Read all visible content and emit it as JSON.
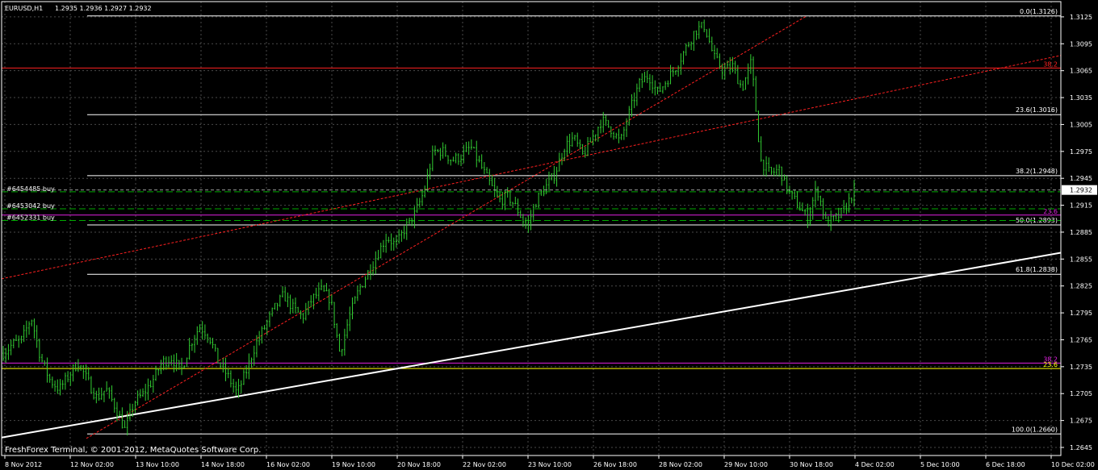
{
  "header": {
    "symbol_tf": "EURUSD,H1",
    "ohlc": "1.2935 1.2936 1.2927 1.2932"
  },
  "footer": {
    "copyright": "FreshForex Terminal, © 2001-2012, MetaQuotes Software Corp."
  },
  "colors": {
    "background": "#000000",
    "frame": "#ffffff",
    "grid": "#4a4a4a",
    "candle": "#32cd32",
    "fib_main": "#ffffff",
    "fib_red": "#ff2020",
    "fib_magenta": "#e020e0",
    "fib_yellow": "#ffff00",
    "order_line": "#00aa00",
    "trend_red": "#ff2020",
    "trend_white": "#ffffff"
  },
  "chart_data": {
    "type": "candlestick",
    "ylim": [
      1.2636,
      1.3142
    ],
    "y_ticks": [
      "1.3125",
      "1.3095",
      "1.3065",
      "1.3035",
      "1.3005",
      "1.2975",
      "1.2945",
      "1.2915",
      "1.2885",
      "1.2855",
      "1.2825",
      "1.2795",
      "1.2765",
      "1.2735",
      "1.2705",
      "1.2675",
      "1.2645"
    ],
    "x_ticks": [
      "8 Nov 2012",
      "12 Nov 02:00",
      "13 Nov 10:00",
      "14 Nov 18:00",
      "16 Nov 02:00",
      "19 Nov 10:00",
      "20 Nov 18:00",
      "22 Nov 02:00",
      "23 Nov 10:00",
      "26 Nov 18:00",
      "28 Nov 02:00",
      "29 Nov 10:00",
      "30 Nov 18:00",
      "4 Dec 02:00",
      "5 Dec 10:00",
      "6 Dec 18:00",
      "10 Dec 02:00"
    ],
    "grid": true,
    "current_price": "1.2932",
    "price_path": [
      [
        0,
        1.275
      ],
      [
        1,
        1.276
      ],
      [
        2,
        1.2765
      ],
      [
        3,
        1.279
      ],
      [
        4,
        1.2745
      ],
      [
        5,
        1.272
      ],
      [
        6,
        1.271
      ],
      [
        7,
        1.2725
      ],
      [
        8,
        1.274
      ],
      [
        9,
        1.272
      ],
      [
        10,
        1.27
      ],
      [
        11,
        1.271
      ],
      [
        12,
        1.269
      ],
      [
        13,
        1.2665
      ],
      [
        14,
        1.2695
      ],
      [
        15,
        1.2705
      ],
      [
        16,
        1.272
      ],
      [
        17,
        1.274
      ],
      [
        18,
        1.2745
      ],
      [
        19,
        1.273
      ],
      [
        20,
        1.276
      ],
      [
        21,
        1.278
      ],
      [
        22,
        1.277
      ],
      [
        23,
        1.274
      ],
      [
        24,
        1.2725
      ],
      [
        25,
        1.2705
      ],
      [
        26,
        1.273
      ],
      [
        27,
        1.276
      ],
      [
        28,
        1.278
      ],
      [
        29,
        1.28
      ],
      [
        30,
        1.2815
      ],
      [
        31,
        1.28
      ],
      [
        32,
        1.279
      ],
      [
        33,
        1.281
      ],
      [
        34,
        1.282
      ],
      [
        35,
        1.281
      ],
      [
        36,
        1.275
      ],
      [
        37,
        1.279
      ],
      [
        38,
        1.282
      ],
      [
        39,
        1.284
      ],
      [
        40,
        1.286
      ],
      [
        41,
        1.288
      ],
      [
        42,
        1.287
      ],
      [
        43,
        1.289
      ],
      [
        44,
        1.2905
      ],
      [
        45,
        1.293
      ],
      [
        46,
        1.2975
      ],
      [
        47,
        1.2975
      ],
      [
        48,
        1.2965
      ],
      [
        49,
        1.297
      ],
      [
        50,
        1.298
      ],
      [
        51,
        1.296
      ],
      [
        52,
        1.294
      ],
      [
        53,
        1.292
      ],
      [
        54,
        1.2925
      ],
      [
        55,
        1.291
      ],
      [
        56,
        1.289
      ],
      [
        57,
        1.292
      ],
      [
        58,
        1.2935
      ],
      [
        59,
        1.295
      ],
      [
        60,
        1.298
      ],
      [
        61,
        1.299
      ],
      [
        62,
        1.297
      ],
      [
        63,
        1.299
      ],
      [
        64,
        1.301
      ],
      [
        65,
        1.3
      ],
      [
        66,
        1.2985
      ],
      [
        67,
        1.302
      ],
      [
        68,
        1.305
      ],
      [
        69,
        1.306
      ],
      [
        70,
        1.304
      ],
      [
        71,
        1.3055
      ],
      [
        72,
        1.307
      ],
      [
        73,
        1.309
      ],
      [
        74,
        1.311
      ],
      [
        75,
        1.3115
      ],
      [
        76,
        1.308
      ],
      [
        77,
        1.3065
      ],
      [
        78,
        1.307
      ],
      [
        79,
        1.3045
      ],
      [
        80,
        1.3075
      ],
      [
        81,
        1.2965
      ],
      [
        82,
        1.295
      ],
      [
        83,
        1.2955
      ],
      [
        84,
        1.293
      ],
      [
        85,
        1.2915
      ],
      [
        86,
        1.29
      ],
      [
        87,
        1.2935
      ],
      [
        88,
        1.2895
      ],
      [
        89,
        1.29
      ],
      [
        90,
        1.291
      ],
      [
        91,
        1.2932
      ]
    ],
    "fib_levels": [
      {
        "label": "0.0(1.3126)",
        "price": 1.3126,
        "color": "#ffffff"
      },
      {
        "label": "23.6(1.3016)",
        "price": 1.3016,
        "color": "#ffffff"
      },
      {
        "label": "38.2(1.2948)",
        "price": 1.2948,
        "color": "#ffffff"
      },
      {
        "label": "50.0(1.2893)",
        "price": 1.2893,
        "color": "#ffffff"
      },
      {
        "label": "61.8(1.2838)",
        "price": 1.2838,
        "color": "#ffffff"
      },
      {
        "label": "100.0(1.2660)",
        "price": 1.266,
        "color": "#ffffff"
      }
    ],
    "extra_levels": [
      {
        "label": "38.2",
        "price": 1.3068,
        "color": "#ff2020"
      },
      {
        "label": "23.6",
        "price": 1.2904,
        "color": "#e020e0"
      },
      {
        "label": "38.2",
        "price": 1.2739,
        "color": "#e020e0"
      },
      {
        "label": "23.6",
        "price": 1.2733,
        "color": "#ffff00"
      }
    ],
    "orders": [
      {
        "label": "#6454485 buy",
        "price": 1.293
      },
      {
        "label": "#6453042 buy",
        "price": 1.2911
      },
      {
        "label": "#6452331 buy",
        "price": 1.2898
      }
    ],
    "trend_lines": [
      {
        "color": "#ff2020",
        "from": [
          0.0,
          1.2833
        ],
        "to": [
          1.0,
          1.3082
        ],
        "dashed": true
      },
      {
        "color": "#ff2020",
        "from": [
          0.08,
          1.2655
        ],
        "to": [
          0.76,
          1.3126
        ],
        "dashed": true
      },
      {
        "color": "#ffffff",
        "from": [
          0.0,
          1.2656
        ],
        "to": [
          1.0,
          1.2862
        ],
        "dashed": false
      }
    ]
  }
}
